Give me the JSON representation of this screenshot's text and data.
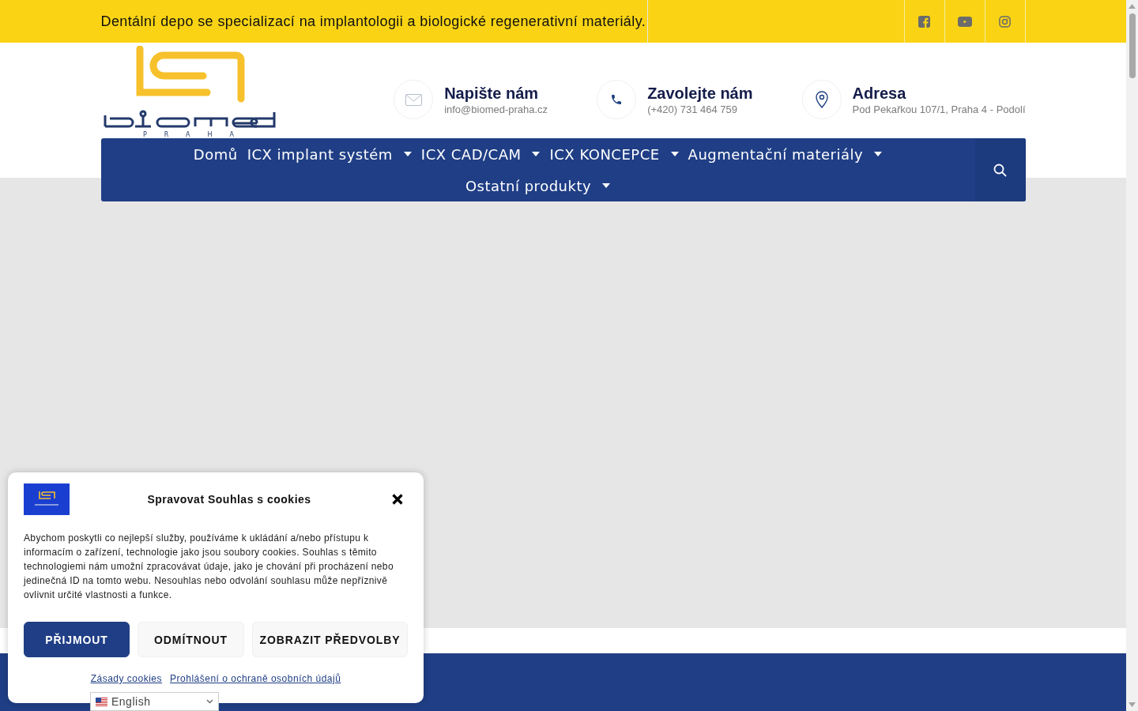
{
  "topbar": {
    "tagline": "Dentální depo se specializací na implantologii a biologické regenerativní materiály.",
    "social": [
      {
        "kind": "facebook"
      },
      {
        "kind": "youtube"
      },
      {
        "kind": "instagram"
      }
    ]
  },
  "header": {
    "logo_subtitle": "PRAHA",
    "contacts": [
      {
        "kind": "mail",
        "title": "Napište nám",
        "detail": "info@biomed-praha.cz"
      },
      {
        "kind": "phone",
        "title": "Zavolejte nám",
        "detail": "(+420) 731 464 759"
      },
      {
        "kind": "pin",
        "title": "Adresa",
        "detail": "Pod Pekařkou 107/1, Praha 4 - Podolí"
      }
    ]
  },
  "nav": {
    "items": [
      {
        "label": "Domů",
        "has_submenu": false
      },
      {
        "label": "ICX implant systém",
        "has_submenu": true
      },
      {
        "label": "ICX CAD/CAM",
        "has_submenu": true
      },
      {
        "label": "ICX KONCEPCE",
        "has_submenu": true
      },
      {
        "label": "Augmentační materiály",
        "has_submenu": true
      },
      {
        "label": "Ostatní produkty",
        "has_submenu": true
      }
    ]
  },
  "cookie_dialog": {
    "title": "Spravovat Souhlas s cookies",
    "text": "Abychom poskytli co nejlepší služby, používáme k ukládání a/nebo přístupu k informacím o zařízení, technologie jako jsou soubory cookies. Souhlas s těmito technologiemi nám umožní zpracovávat údaje, jako je chování při procházení nebo jedinečná ID na tomto webu. Nesouhlas nebo odvolání souhlasu může nepříznivě ovlivnit určité vlastnosti a funkce.",
    "buttons": [
      {
        "label": "PŘIJMOUT",
        "kind": "primary"
      },
      {
        "label": "ODMÍTNOUT",
        "kind": "secondary"
      },
      {
        "label": "ZOBRAZIT PŘEDVOLBY",
        "kind": "secondary"
      }
    ],
    "links": [
      "Zásady cookies",
      "Prohlášení o ochraně osobních údajů"
    ]
  },
  "language_selector": {
    "value": "English"
  }
}
